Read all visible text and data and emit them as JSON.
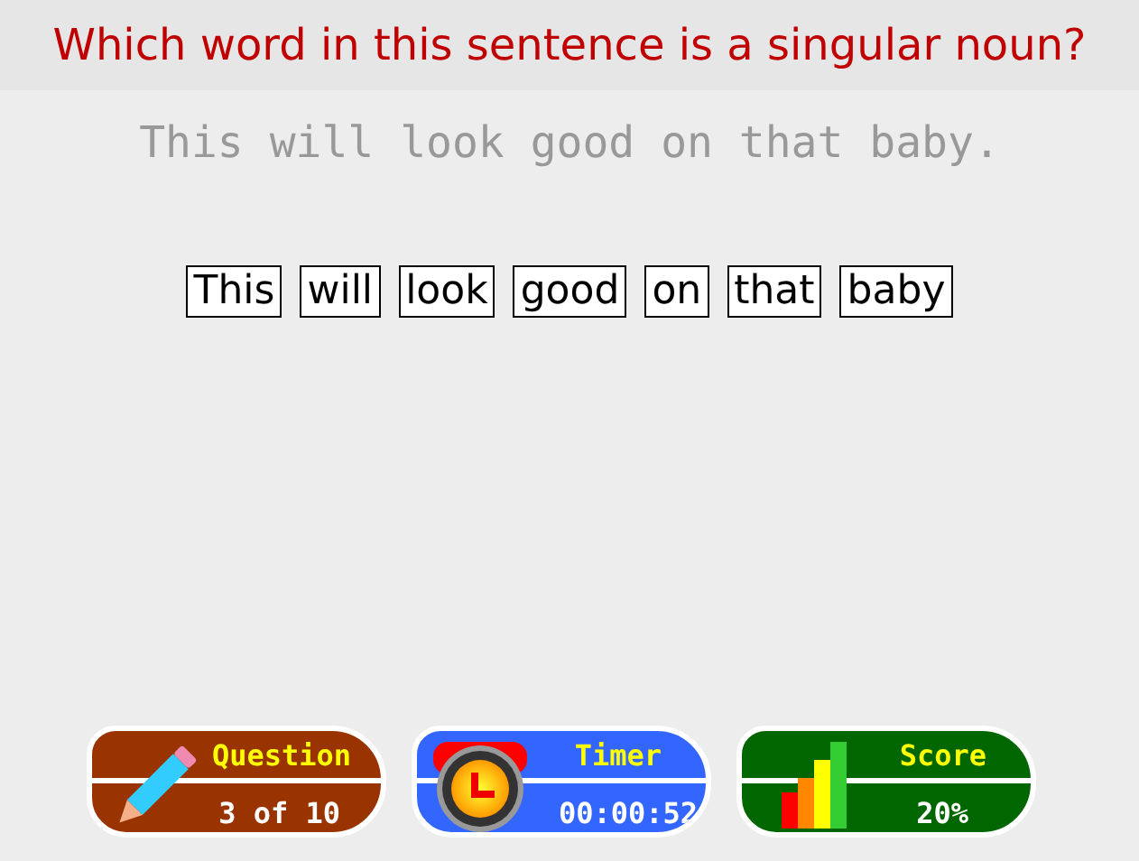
{
  "question": "Which word in this sentence is a singular noun?",
  "sentence": "This will look good on that baby.",
  "words": [
    "This",
    "will",
    "look",
    "good",
    "on",
    "that",
    "baby"
  ],
  "badges": [
    {
      "kind": "question",
      "color": "#993300",
      "label": "Question",
      "value": "3 of 10"
    },
    {
      "kind": "timer",
      "color": "#3366ff",
      "label": "Timer",
      "value": "00:00:52"
    },
    {
      "kind": "score",
      "color": "#006600",
      "label": "Score",
      "value": "20%"
    }
  ]
}
